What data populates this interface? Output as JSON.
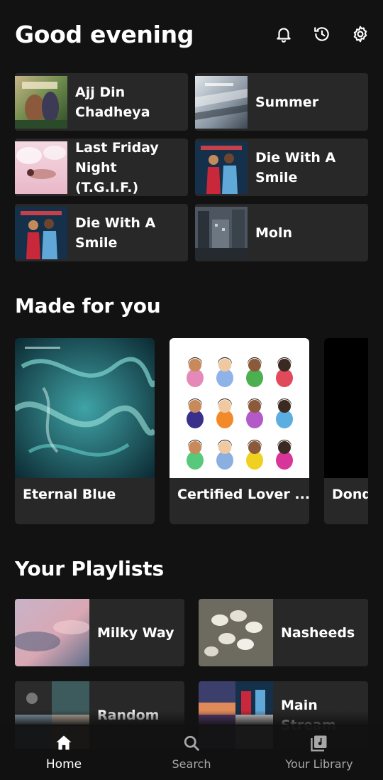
{
  "header": {
    "greeting": "Good evening",
    "icons": [
      "bell-icon",
      "history-icon",
      "settings-icon"
    ]
  },
  "quick": [
    {
      "label": "Ajj Din Chadheya",
      "thumb": "album-art-love-aaj-kal"
    },
    {
      "label": "Summer",
      "thumb": "album-art-summer"
    },
    {
      "label": "Last Friday Night (T.G.I.F.)",
      "thumb": "album-art-teenage-dream"
    },
    {
      "label": "Die With A Smile",
      "thumb": "album-art-die-with-a-smile"
    },
    {
      "label": "Die With A Smile",
      "thumb": "album-art-die-with-a-smile"
    },
    {
      "label": "Moln",
      "thumb": "album-art-moln"
    }
  ],
  "made_for_you": {
    "title": "Made for you",
    "items": [
      {
        "label": "Eternal Blue"
      },
      {
        "label": "Certified Lover ..."
      },
      {
        "label": "Dond"
      }
    ]
  },
  "playlists": {
    "title": "Your Playlists",
    "items": [
      {
        "label": "Milky Way"
      },
      {
        "label": "Nasheeds"
      },
      {
        "label": "Random"
      },
      {
        "label": "Main Stream"
      }
    ]
  },
  "nav": {
    "home": "Home",
    "search": "Search",
    "library": "Your Library"
  },
  "colors": {
    "background": "#121212",
    "card": "#282828",
    "text": "#ffffff",
    "muted": "#a7a7a7"
  }
}
